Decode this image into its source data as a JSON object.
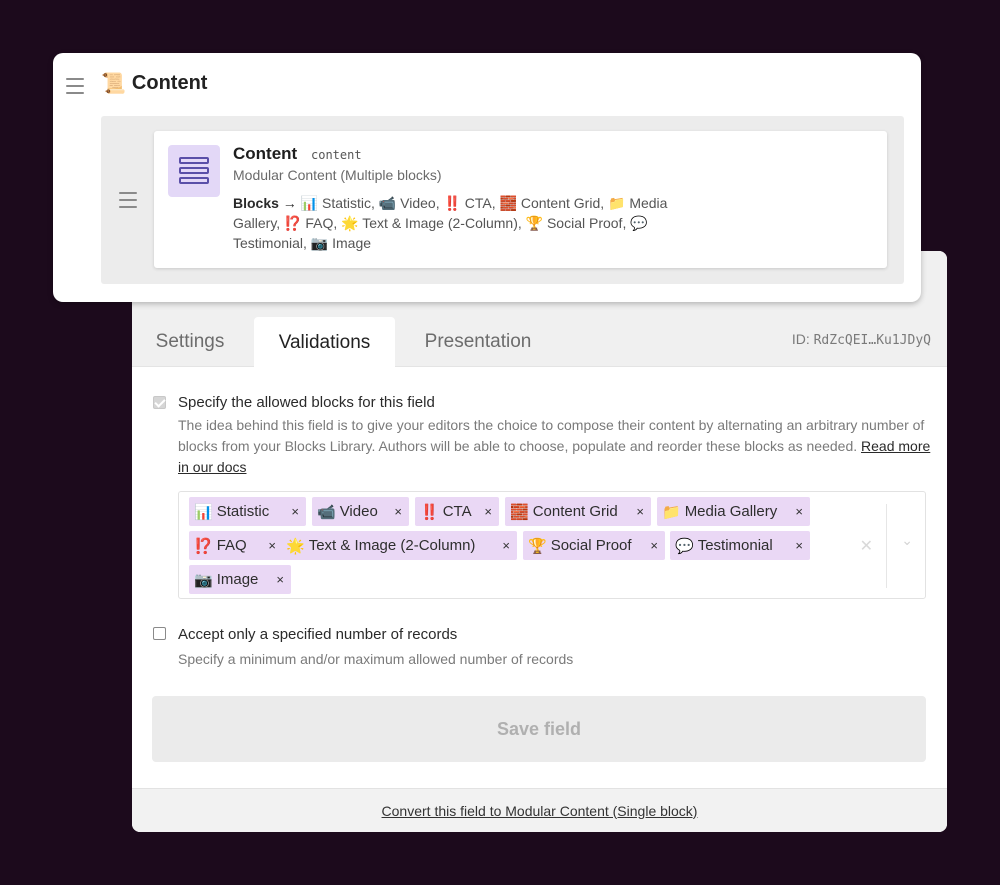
{
  "card": {
    "title": "Content",
    "title_icon": "📜",
    "block": {
      "name": "Content",
      "api_key": "content",
      "type": "Modular Content (Multiple blocks)",
      "blocks_label": "Blocks →",
      "blocks_summary": "📊 Statistic, 📹 Video, ‼️ CTA, 🧱 Content Grid, 📁 Media Gallery, ⁉️ FAQ, 🌟 Text & Image (2-Column), 🏆 Social Proof, 💬 Testimonial, 📷 Image"
    }
  },
  "tabs": [
    {
      "label": "Settings",
      "active": false
    },
    {
      "label": "Validations",
      "active": true
    },
    {
      "label": "Presentation",
      "active": false
    }
  ],
  "field_id": {
    "label": "ID:",
    "value": "RdZcQEI…Ku1JDyQ"
  },
  "validations": {
    "allowed_blocks": {
      "checked": true,
      "title": "Specify the allowed blocks for this field",
      "hint": "The idea behind this field is to give your editors the choice to compose their content by alternating an arbitrary number of blocks from your Blocks Library. Authors will be able to choose, populate and reorder these blocks as needed.",
      "link": "Read more in our docs"
    },
    "tags": [
      {
        "icon": "📊",
        "label": "Statistic"
      },
      {
        "icon": "📹",
        "label": "Video"
      },
      {
        "icon": "‼️",
        "label": "CTA"
      },
      {
        "icon": "🧱",
        "label": "Content Grid"
      },
      {
        "icon": "📁",
        "label": "Media Gallery"
      },
      {
        "icon": "⁉️",
        "label": "FAQ"
      },
      {
        "icon": "🌟",
        "label": "Text & Image (2-Column)"
      },
      {
        "icon": "🏆",
        "label": "Social Proof"
      },
      {
        "icon": "💬",
        "label": "Testimonial"
      },
      {
        "icon": "📷",
        "label": "Image"
      }
    ],
    "tag_remove": "×",
    "records_limit": {
      "checked": false,
      "title": "Accept only a specified number of records",
      "hint": "Specify a minimum and/or maximum allowed number of records"
    }
  },
  "save_button": "Save field",
  "footer_link": "Convert this field to Modular Content (Single block)",
  "colors": {
    "background": "#1c0a1c",
    "tag": "#ead8f5",
    "block_icon_bg": "#e3d8f7",
    "block_icon_fg": "#5a4fa8"
  }
}
